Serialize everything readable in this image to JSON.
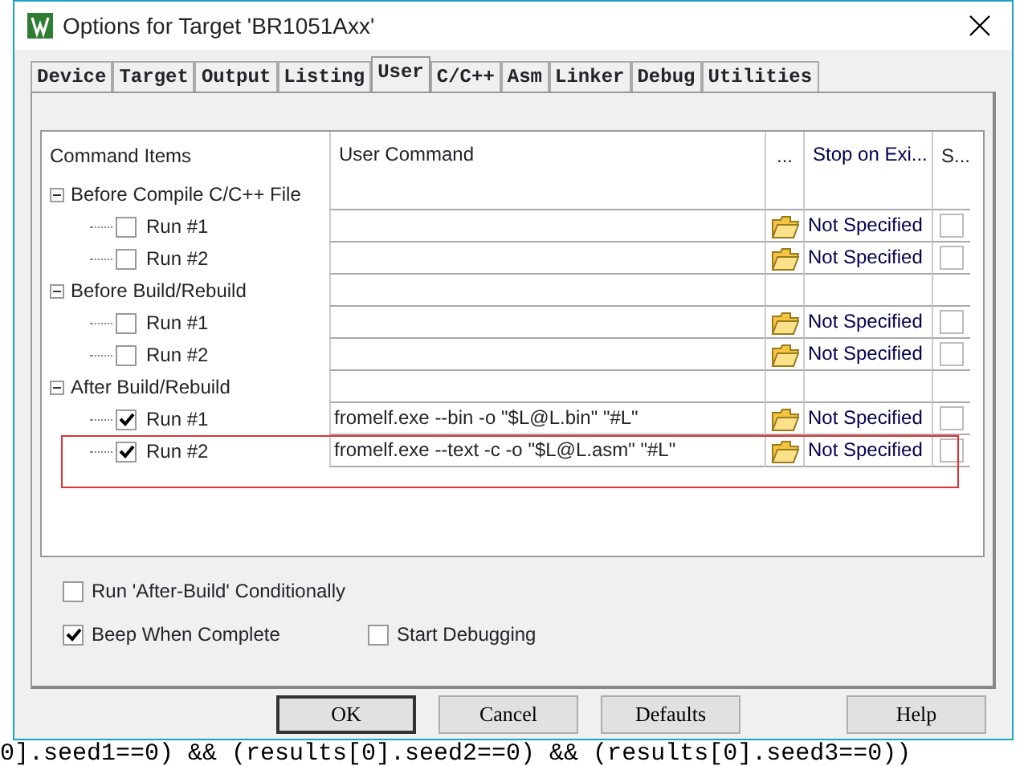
{
  "window": {
    "title": "Options for Target 'BR1051Axx'"
  },
  "tabs": [
    {
      "label": "Device",
      "selected": false
    },
    {
      "label": "Target",
      "selected": false
    },
    {
      "label": "Output",
      "selected": false
    },
    {
      "label": "Listing",
      "selected": false
    },
    {
      "label": "User",
      "selected": true
    },
    {
      "label": "C/C++",
      "selected": false
    },
    {
      "label": "Asm",
      "selected": false
    },
    {
      "label": "Linker",
      "selected": false
    },
    {
      "label": "Debug",
      "selected": false
    },
    {
      "label": "Utilities",
      "selected": false
    }
  ],
  "table": {
    "columns": [
      "Command Items",
      "User Command",
      "...",
      "Stop on Exi...",
      "S..."
    ],
    "groups": [
      {
        "label": "Before Compile C/C++ File",
        "expanded": true,
        "children": [
          {
            "label": "Run #1",
            "checked": false,
            "stop": "Not Specified",
            "s_checked": false,
            "highlighted": false
          },
          {
            "label": "Run #2",
            "checked": false,
            "stop": "Not Specified",
            "s_checked": false,
            "highlighted": false
          }
        ]
      },
      {
        "label": "Before Build/Rebuild",
        "expanded": true,
        "children": [
          {
            "label": "Run #1",
            "checked": false,
            "stop": "Not Specified",
            "s_checked": false,
            "highlighted": false
          },
          {
            "label": "Run #2",
            "checked": false,
            "stop": "Not Specified",
            "s_checked": false,
            "highlighted": false
          }
        ]
      },
      {
        "label": "After Build/Rebuild",
        "expanded": true,
        "children": [
          {
            "label": "Run #1",
            "checked": true,
            "command": "fromelf.exe --bin -o \"$L@L.bin\" \"#L\"",
            "stop": "Not Specified",
            "s_checked": false,
            "highlighted": false
          },
          {
            "label": "Run #2",
            "checked": true,
            "command": "fromelf.exe --text -c -o \"$L@L.asm\" \"#L\"",
            "stop": "Not Specified",
            "s_checked": false,
            "highlighted": true
          }
        ]
      }
    ]
  },
  "options": [
    {
      "label": "Run 'After-Build' Conditionally",
      "checked": false
    },
    {
      "label": "Beep When Complete",
      "checked": true
    },
    {
      "label": "Start Debugging",
      "checked": false
    }
  ],
  "buttons": [
    {
      "label": "OK",
      "default": true
    },
    {
      "label": "Cancel",
      "default": false
    },
    {
      "label": "Defaults",
      "default": false
    },
    {
      "label": "Help",
      "default": false
    }
  ],
  "background_code": "0].seed1==0) && (results[0].seed2==0) && (results[0].seed3==0))"
}
